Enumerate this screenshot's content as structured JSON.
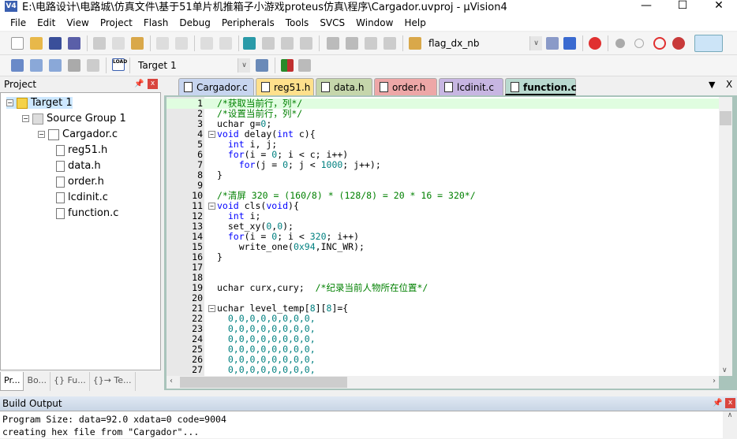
{
  "window": {
    "title": "E:\\电路设计\\电路城\\仿真文件\\基于51单片机推箱子小游戏proteus仿真\\程序\\Cargador.uvproj - µVision4",
    "app_icon": "V4",
    "minimize": "—",
    "maximize": "☐",
    "close": "✕"
  },
  "menu": [
    "File",
    "Edit",
    "View",
    "Project",
    "Flash",
    "Debug",
    "Peripherals",
    "Tools",
    "SVCS",
    "Window",
    "Help"
  ],
  "toolbar": {
    "find_combo": "flag_dx_nb",
    "target_combo": "Target 1",
    "load_label": "LOAD"
  },
  "project_panel": {
    "title": "Project",
    "pin": "📌",
    "close": "x",
    "tree": {
      "target": "Target 1",
      "group": "Source Group 1",
      "file": "Cargador.c",
      "includes": [
        "reg51.h",
        "data.h",
        "order.h",
        "lcdinit.c",
        "function.c"
      ]
    },
    "tabs": [
      "Pr...",
      "Bo...",
      "{} Fu...",
      "{}→ Te..."
    ]
  },
  "editor": {
    "tabs": [
      {
        "label": "Cargador.c",
        "color": "#c7d5ef"
      },
      {
        "label": "reg51.h",
        "color": "#ffe08c"
      },
      {
        "label": "data.h",
        "color": "#c5d6ab"
      },
      {
        "label": "order.h",
        "color": "#eda7a7"
      },
      {
        "label": "lcdinit.c",
        "color": "#c7b6e2"
      },
      {
        "label": "function.c",
        "color": "#b9d9cf",
        "active": true
      }
    ],
    "tab_menu": "▼",
    "tab_close": "X",
    "current_line": 1,
    "lines": [
      [
        [
          "cm",
          "/*获取当前行，列*/"
        ]
      ],
      [
        [
          "cm",
          "/*设置当前行，列*/"
        ]
      ],
      [
        [
          "",
          "uchar g="
        ],
        [
          "nu",
          "0"
        ],
        [
          "",
          ";"
        ]
      ],
      [
        [
          "kw",
          "void"
        ],
        [
          "",
          " delay("
        ],
        [
          "kw",
          "int"
        ],
        [
          "",
          " c){"
        ]
      ],
      [
        [
          "",
          "  "
        ],
        [
          "kw",
          "int"
        ],
        [
          "",
          " i, j;"
        ]
      ],
      [
        [
          "",
          "  "
        ],
        [
          "kw",
          "for"
        ],
        [
          "",
          "(i = "
        ],
        [
          "nu",
          "0"
        ],
        [
          "",
          "; i < c; i++)"
        ]
      ],
      [
        [
          "",
          "    "
        ],
        [
          "kw",
          "for"
        ],
        [
          "",
          "(j = "
        ],
        [
          "nu",
          "0"
        ],
        [
          "",
          "; j < "
        ],
        [
          "nu",
          "1000"
        ],
        [
          "",
          "; j++);"
        ]
      ],
      [
        [
          "",
          "}"
        ]
      ],
      [],
      [
        [
          "cm",
          "/*清屏 320 = (160/8) * (128/8) = 20 * 16 = 320*/"
        ]
      ],
      [
        [
          "kw",
          "void"
        ],
        [
          "",
          " cls("
        ],
        [
          "kw",
          "void"
        ],
        [
          "",
          "){"
        ]
      ],
      [
        [
          "",
          "  "
        ],
        [
          "kw",
          "int"
        ],
        [
          "",
          " i;"
        ]
      ],
      [
        [
          "",
          "  set_xy("
        ],
        [
          "nu",
          "0"
        ],
        [
          "",
          ","
        ],
        [
          "nu",
          "0"
        ],
        [
          "",
          ");"
        ]
      ],
      [
        [
          "",
          "  "
        ],
        [
          "kw",
          "for"
        ],
        [
          "",
          "(i = "
        ],
        [
          "nu",
          "0"
        ],
        [
          "",
          "; i < "
        ],
        [
          "nu",
          "320"
        ],
        [
          "",
          "; i++)"
        ]
      ],
      [
        [
          "",
          "    write_one("
        ],
        [
          "nu",
          "0x94"
        ],
        [
          "",
          ",INC_WR);"
        ]
      ],
      [
        [
          "",
          "}"
        ]
      ],
      [],
      [],
      [
        [
          "",
          "uchar curx,cury;  "
        ],
        [
          "cm",
          "/*纪录当前人物所在位置*/"
        ]
      ],
      [],
      [
        [
          "",
          "uchar level_temp["
        ],
        [
          "nu",
          "8"
        ],
        [
          "",
          "]["
        ],
        [
          "nu",
          "8"
        ],
        [
          "",
          "]={"
        ]
      ],
      [
        [
          "",
          "  "
        ],
        [
          "nu",
          "0,0,0,0,0,0,0,0,"
        ]
      ],
      [
        [
          "",
          "  "
        ],
        [
          "nu",
          "0,0,0,0,0,0,0,0,"
        ]
      ],
      [
        [
          "",
          "  "
        ],
        [
          "nu",
          "0,0,0,0,0,0,0,0,"
        ]
      ],
      [
        [
          "",
          "  "
        ],
        [
          "nu",
          "0,0,0,0,0,0,0,0,"
        ]
      ],
      [
        [
          "",
          "  "
        ],
        [
          "nu",
          "0,0,0,0,0,0,0,0,"
        ]
      ],
      [
        [
          "",
          "  "
        ],
        [
          "nu",
          "0,0,0,0,0,0,0,0,"
        ]
      ]
    ],
    "fold_lines": [
      4,
      11,
      21
    ]
  },
  "build_output": {
    "title": "Build Output",
    "pin": "📌",
    "close": "x",
    "lines": [
      "Program Size: data=92.0 xdata=0 code=9004",
      "creating hex file from \"Cargador\"..."
    ]
  }
}
